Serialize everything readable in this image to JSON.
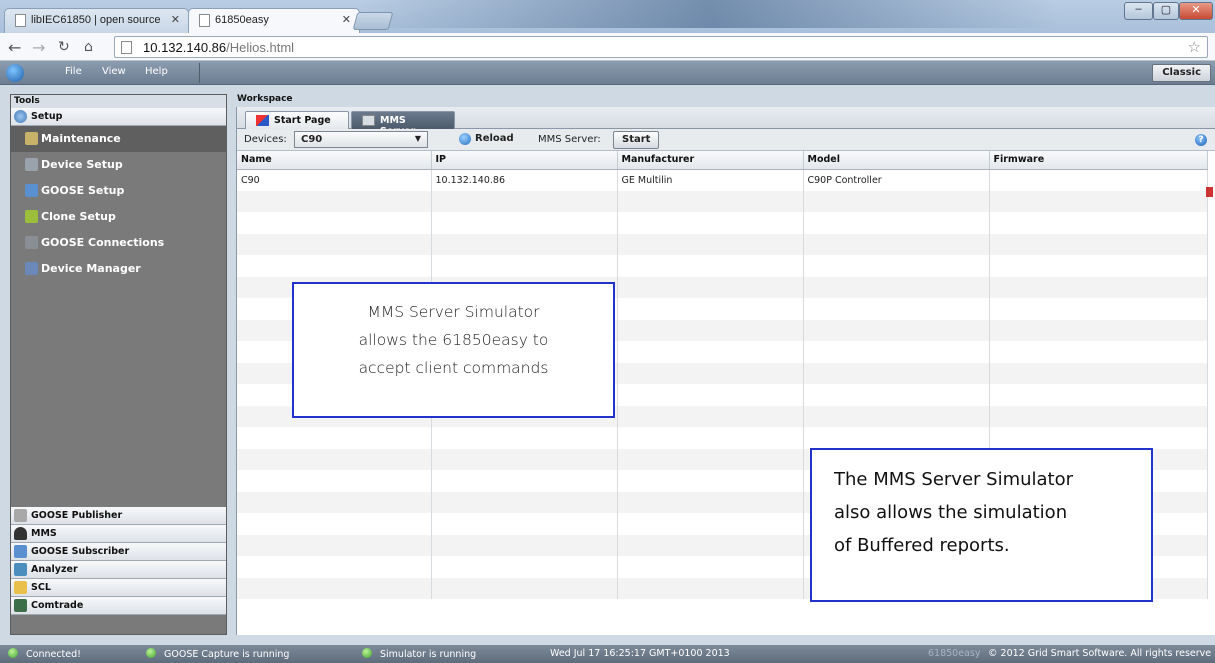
{
  "browser": {
    "tabs": [
      {
        "label": "libIEC61850 | open source"
      },
      {
        "label": "61850easy"
      }
    ],
    "url_host": "10.132.140.86",
    "url_path": "/Helios.html",
    "window_controls": [
      "–",
      "▢",
      "✕"
    ]
  },
  "app": {
    "menu": [
      "File",
      "View",
      "Help"
    ],
    "classic_button": "Classic"
  },
  "tools": {
    "header": "Tools",
    "setup_label": "Setup",
    "items": [
      {
        "label": "Maintenance",
        "icon": "wrench-icon",
        "color": "#c8b26a"
      },
      {
        "label": "Device Setup",
        "icon": "device-icon",
        "color": "#9aa3ad"
      },
      {
        "label": "GOOSE Setup",
        "icon": "goose-setup-icon",
        "color": "#5a8fd0"
      },
      {
        "label": "Clone Setup",
        "icon": "clone-icon",
        "color": "#9bbf3a"
      },
      {
        "label": "GOOSE Connections",
        "icon": "connections-icon",
        "color": "#8a8f96"
      },
      {
        "label": "Device Manager",
        "icon": "manager-icon",
        "color": "#6a88b8"
      }
    ],
    "bottom_sections": [
      {
        "label": "GOOSE Publisher",
        "icon": "publisher-icon",
        "color": "#a8a8a8"
      },
      {
        "label": "MMS",
        "icon": "user-icon",
        "color": "#333333"
      },
      {
        "label": "GOOSE Subscriber",
        "icon": "subscriber-icon",
        "color": "#5a8fd0"
      },
      {
        "label": "Analyzer",
        "icon": "analyzer-icon",
        "color": "#4c8fbf"
      },
      {
        "label": "SCL",
        "icon": "folder-icon",
        "color": "#e8c04a"
      },
      {
        "label": "Comtrade",
        "icon": "comtrade-icon",
        "color": "#3d6e4a"
      }
    ]
  },
  "workspace": {
    "header": "Workspace",
    "tabs": [
      {
        "label": "Start Page"
      },
      {
        "label": "MMS Server"
      }
    ],
    "toolbar": {
      "devices_label": "Devices:",
      "device_selected": "C90",
      "reload_label": "Reload",
      "mms_server_label": "MMS Server:",
      "start_label": "Start",
      "help_glyph": "?"
    },
    "columns": [
      "Name",
      "IP",
      "Manufacturer",
      "Model",
      "Firmware"
    ],
    "rows": [
      [
        "C90",
        "10.132.140.86",
        "GE Multilin",
        "C90P Controller",
        ""
      ]
    ]
  },
  "callouts": {
    "first": [
      "MMS Server Simulator",
      "allows the 61850easy to",
      "accept client commands"
    ],
    "second": [
      "The MMS Server Simulator",
      "also allows the simulation",
      "of Buffered reports."
    ]
  },
  "status": {
    "connected": "Connected!",
    "goose_capture": "GOOSE Capture is running",
    "simulator": "Simulator is running",
    "datetime": "Wed Jul 17 16:25:17 GMT+0100 2013",
    "version": "61850easy",
    "copyright": "© 2012 Grid Smart Software. All rights reserve"
  }
}
